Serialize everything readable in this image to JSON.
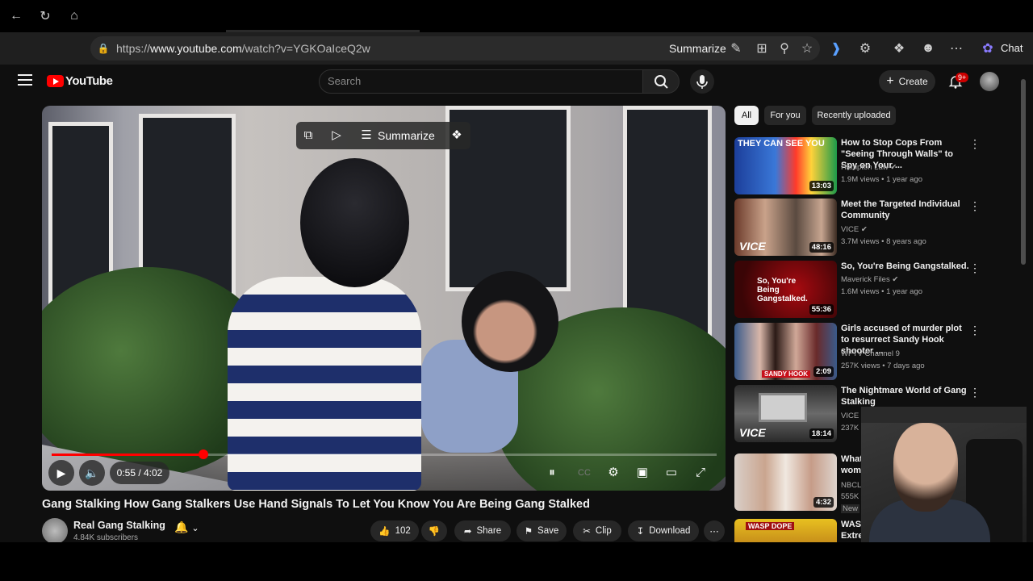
{
  "browser": {
    "url_prefix": "https://",
    "url_host": "www.youtube.com",
    "url_path": "/watch?v=YGKOaIceQ2w",
    "summarize_label": "Summarize",
    "chat_label": "Chat"
  },
  "header": {
    "logo_text": "YouTube",
    "search_placeholder": "Search",
    "create_label": "Create",
    "notif_badge": "9+"
  },
  "player": {
    "summarize_label": "Summarize",
    "time": "0:55 / 4:02",
    "progress": 0.2285
  },
  "video": {
    "title": "Gang Stalking How Gang Stalkers Use Hand Signals To Let You Know You Are Being Gang Stalked",
    "channel": "Real Gang Stalking",
    "subscribers": "4.84K subscribers",
    "likes": "102",
    "share": "Share",
    "save": "Save",
    "clip": "Clip",
    "download": "Download"
  },
  "chips": [
    "All",
    "For you",
    "Recently uploaded"
  ],
  "recommendations": [
    {
      "title": "How to Stop Cops From \"Seeing Through Walls\" to Spy on Your ...",
      "channel": "Hampton Law",
      "meta": "1.9M views • 1 year ago",
      "duration": "13:03",
      "thumb_text": "THEY CAN SEE YOU"
    },
    {
      "title": "Meet the Targeted Individual Community",
      "channel": "VICE",
      "meta": "3.7M views • 8 years ago",
      "duration": "48:16",
      "thumb_text": "VICE"
    },
    {
      "title": "So, You're Being Gangstalked.",
      "channel": "Maverick Files",
      "meta": "1.6M views • 1 year ago",
      "duration": "55:36",
      "thumb_text": "So, You're Being Gangstalked."
    },
    {
      "title": "Girls accused of murder plot to resurrect Sandy Hook shooter ...",
      "channel": "WFTV Channel 9",
      "meta": "257K views • 7 days ago",
      "duration": "2:09",
      "thumb_text": "SANDY HOOK"
    },
    {
      "title": "The Nightmare World of Gang Stalking",
      "channel": "VICE",
      "meta": "237K",
      "duration": "18:14",
      "thumb_text": "VICE"
    },
    {
      "title": "What",
      "title2": "wom",
      "channel": "NBCL",
      "meta": "555K",
      "meta2": "New",
      "duration": "4:32",
      "thumb_text": ""
    },
    {
      "title": "WASI",
      "title2": "Extre",
      "thumb_text": "WASP DOPE"
    }
  ]
}
